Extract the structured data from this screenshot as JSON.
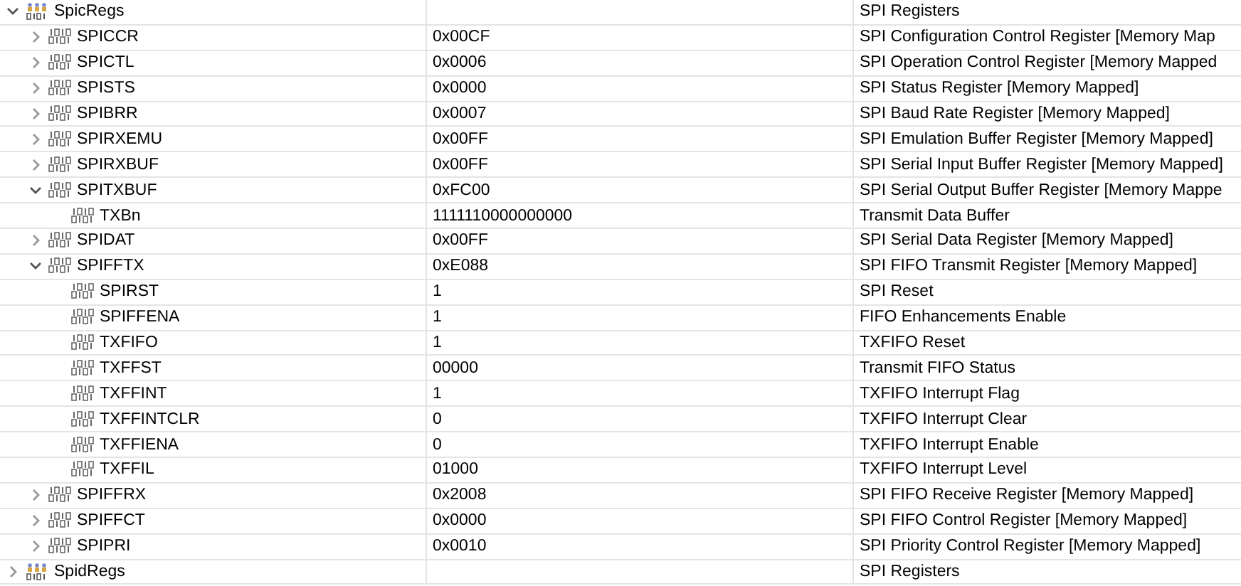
{
  "tree": [
    {
      "kind": "group",
      "name": "SpicRegs",
      "description": "SPI Registers",
      "expanded": true,
      "children": [
        {
          "kind": "register",
          "name": "SPICCR",
          "value": "0x00CF",
          "description": "SPI Configuration Control Register [Memory Map",
          "expanded": false
        },
        {
          "kind": "register",
          "name": "SPICTL",
          "value": "0x0006",
          "description": "SPI Operation Control Register [Memory Mapped",
          "expanded": false
        },
        {
          "kind": "register",
          "name": "SPISTS",
          "value": "0x0000",
          "description": "SPI Status Register [Memory Mapped]",
          "expanded": false
        },
        {
          "kind": "register",
          "name": "SPIBRR",
          "value": "0x0007",
          "description": "SPI Baud Rate Register [Memory Mapped]",
          "expanded": false
        },
        {
          "kind": "register",
          "name": "SPIRXEMU",
          "value": "0x00FF",
          "description": "SPI Emulation Buffer Register [Memory Mapped]",
          "expanded": false
        },
        {
          "kind": "register",
          "name": "SPIRXBUF",
          "value": "0x00FF",
          "description": "SPI Serial Input Buffer Register [Memory Mapped]",
          "expanded": false
        },
        {
          "kind": "register",
          "name": "SPITXBUF",
          "value": "0xFC00",
          "description": "SPI Serial Output Buffer Register [Memory Mappe",
          "expanded": true,
          "children": [
            {
              "kind": "field",
              "name": "TXBn",
              "value": "1111110000000000",
              "description": "Transmit Data Buffer"
            }
          ]
        },
        {
          "kind": "register",
          "name": "SPIDAT",
          "value": "0x00FF",
          "description": "SPI Serial Data Register [Memory Mapped]",
          "expanded": false
        },
        {
          "kind": "register",
          "name": "SPIFFTX",
          "value": "0xE088",
          "description": "SPI FIFO Transmit Register [Memory Mapped]",
          "expanded": true,
          "children": [
            {
              "kind": "field",
              "name": "SPIRST",
              "value": "1",
              "description": "SPI Reset"
            },
            {
              "kind": "field",
              "name": "SPIFFENA",
              "value": "1",
              "description": "FIFO Enhancements Enable"
            },
            {
              "kind": "field",
              "name": "TXFIFO",
              "value": "1",
              "description": "TXFIFO Reset"
            },
            {
              "kind": "field",
              "name": "TXFFST",
              "value": "00000",
              "description": "Transmit FIFO Status"
            },
            {
              "kind": "field",
              "name": "TXFFINT",
              "value": "1",
              "description": "TXFIFO Interrupt Flag"
            },
            {
              "kind": "field",
              "name": "TXFFINTCLR",
              "value": "0",
              "description": "TXFIFO Interrupt Clear"
            },
            {
              "kind": "field",
              "name": "TXFFIENA",
              "value": "0",
              "description": "TXFIFO Interrupt Enable"
            },
            {
              "kind": "field",
              "name": "TXFFIL",
              "value": "01000",
              "description": "TXFIFO Interrupt Level"
            }
          ]
        },
        {
          "kind": "register",
          "name": "SPIFFRX",
          "value": "0x2008",
          "description": "SPI FIFO Receive Register [Memory Mapped]",
          "expanded": false
        },
        {
          "kind": "register",
          "name": "SPIFFCT",
          "value": "0x0000",
          "description": "SPI FIFO Control Register [Memory Mapped]",
          "expanded": false
        },
        {
          "kind": "register",
          "name": "SPIPRI",
          "value": "0x0010",
          "description": "SPI Priority Control Register [Memory Mapped]",
          "expanded": false
        }
      ]
    },
    {
      "kind": "group",
      "name": "SpidRegs",
      "description": "SPI Registers",
      "expanded": false
    }
  ]
}
